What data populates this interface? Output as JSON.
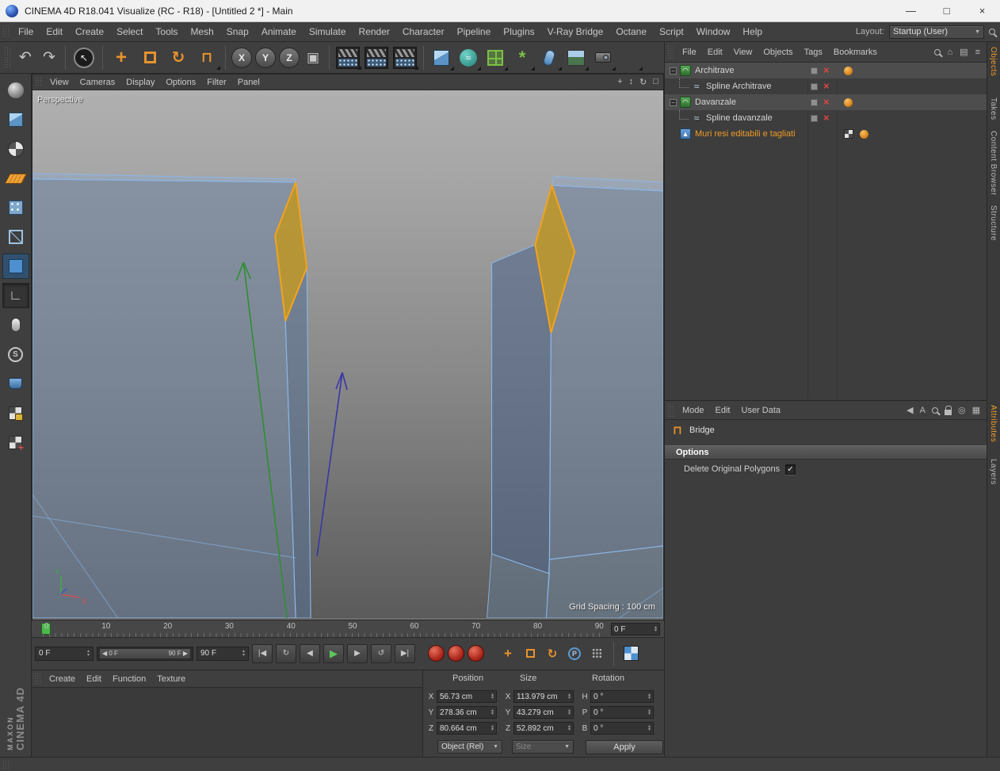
{
  "window": {
    "title": "CINEMA 4D R18.041 Visualize (RC - R18) - [Untitled 2 *] - Main",
    "minimize_glyph": "—",
    "maximize_glyph": "□",
    "close_glyph": "×"
  },
  "menubar": {
    "items": [
      "File",
      "Edit",
      "Create",
      "Select",
      "Tools",
      "Mesh",
      "Snap",
      "Animate",
      "Simulate",
      "Render",
      "Character",
      "Pipeline",
      "Plugins",
      "V-Ray Bridge",
      "Octane",
      "Script",
      "Window",
      "Help"
    ],
    "layout_label": "Layout:",
    "layout_value": "Startup (User)"
  },
  "toolbar": {
    "axis_labels": [
      "X",
      "Y",
      "Z"
    ]
  },
  "viewport": {
    "menus": [
      "View",
      "Cameras",
      "Display",
      "Options",
      "Filter",
      "Panel"
    ],
    "camera_label": "Perspective",
    "grid_spacing_label": "Grid Spacing : 100 cm"
  },
  "object_manager": {
    "menus": [
      "File",
      "Edit",
      "View",
      "Objects",
      "Tags",
      "Bookmarks"
    ],
    "objects": [
      {
        "label": "Architrave"
      },
      {
        "label": "Spline Architrave"
      },
      {
        "label": "Davanzale"
      },
      {
        "label": "Spline davanzale"
      },
      {
        "label": "Muri resi editabili e tagliati"
      }
    ]
  },
  "right_tabs": {
    "upper": [
      "Objects",
      "Takes",
      "Content Browser",
      "Structure"
    ],
    "lower": [
      "Attributes",
      "Layers"
    ]
  },
  "attribute_manager": {
    "menus": [
      "Mode",
      "Edit",
      "User Data"
    ],
    "tool_name": "Bridge",
    "section_title": "Options",
    "option_label": "Delete Original Polygons",
    "option_check_glyph": "✓"
  },
  "timeline": {
    "ticks": [
      "0",
      "10",
      "20",
      "30",
      "40",
      "50",
      "60",
      "70",
      "80",
      "90"
    ],
    "current_frame": "0 F",
    "frame_start": "0 F",
    "range_start": "0 F",
    "range_end": "90 F",
    "frame_end": "90 F"
  },
  "material_manager": {
    "menus": [
      "Create",
      "Edit",
      "Function",
      "Texture"
    ]
  },
  "branding": {
    "maxon": "MAXON",
    "cinema": "CINEMA 4D"
  },
  "coordinates": {
    "headers": [
      "Position",
      "Size",
      "Rotation"
    ],
    "pos_labels": [
      "X",
      "Y",
      "Z"
    ],
    "size_labels": [
      "X",
      "Y",
      "Z"
    ],
    "rot_labels": [
      "H",
      "P",
      "B"
    ],
    "position": [
      "56.73 cm",
      "278.36 cm",
      "80.664 cm"
    ],
    "size": [
      "113.979 cm",
      "43.279 cm",
      "52.892 cm"
    ],
    "rotation": [
      "0 °",
      "0 °",
      "0 °"
    ],
    "mode_dropdown": "Object (Rel)",
    "size_dropdown": "Size",
    "apply_label": "Apply"
  }
}
